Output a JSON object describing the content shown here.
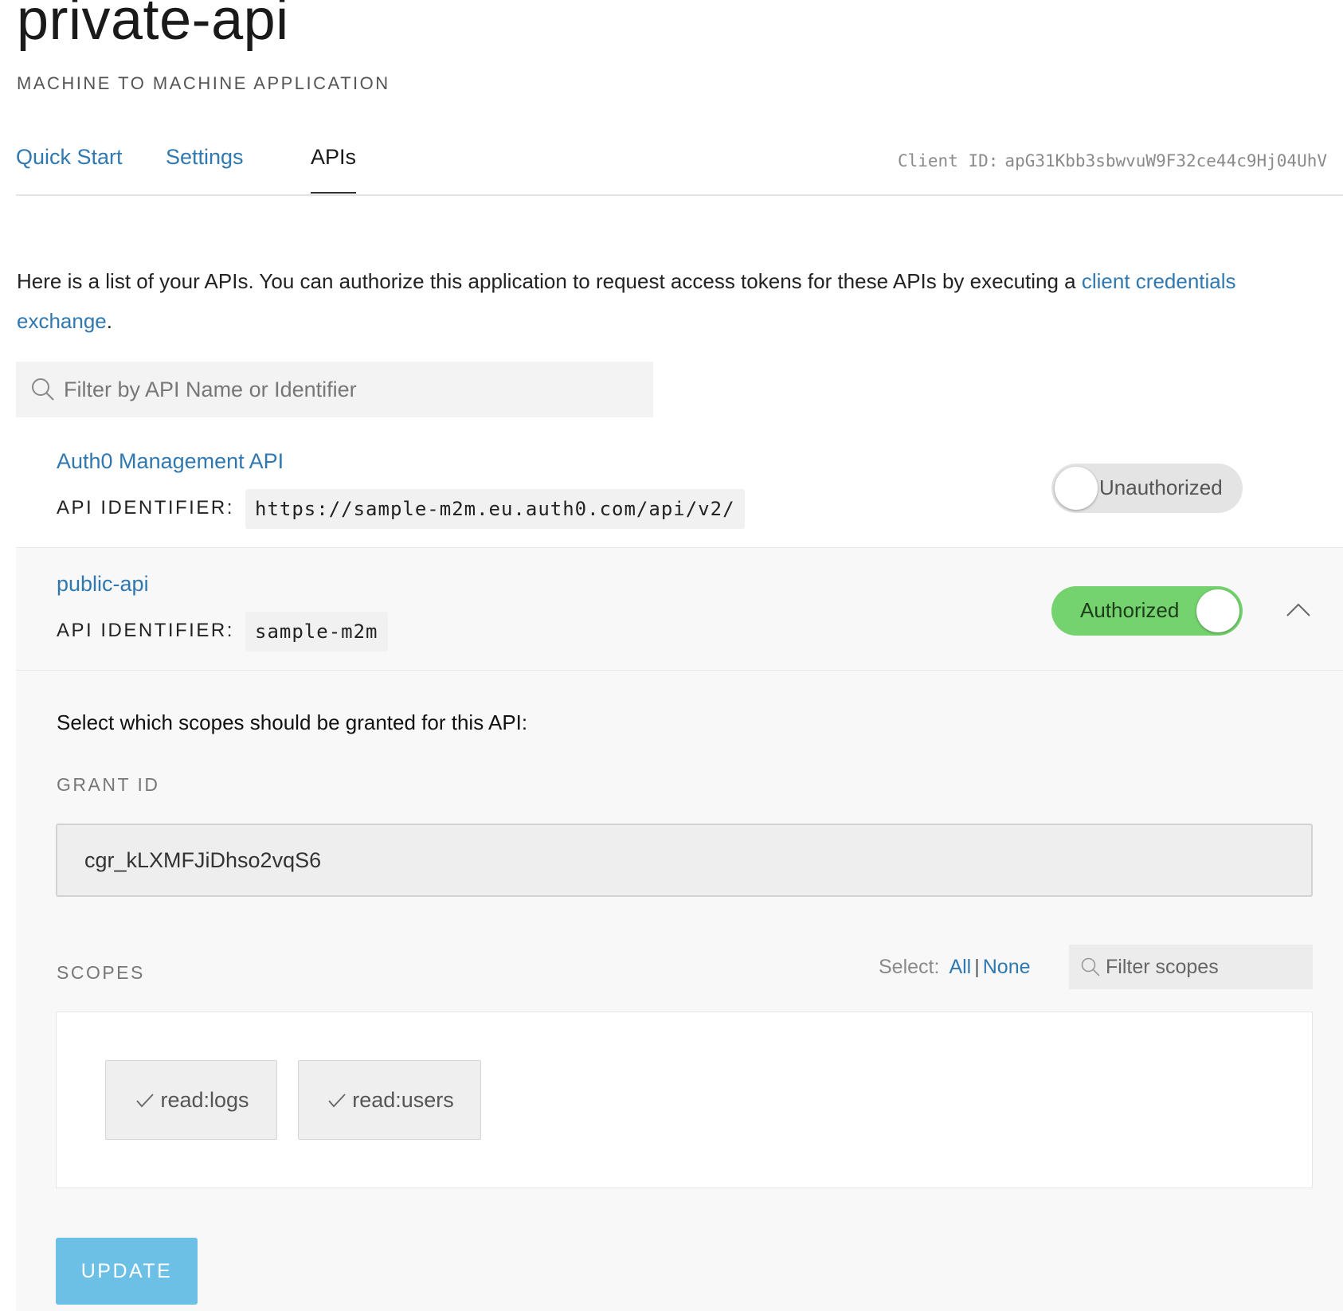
{
  "app": {
    "title": "private-api",
    "type": "MACHINE TO MACHINE APPLICATION"
  },
  "tabs": [
    {
      "label": "Quick Start"
    },
    {
      "label": "Settings"
    },
    {
      "label": "APIs",
      "active": true
    }
  ],
  "client_id": {
    "label": "Client ID:",
    "value": "apG31Kbb3sbwvuW9F32ce44c9Hj04UhV"
  },
  "intro": {
    "text": "Here is a list of your APIs. You can authorize this application to request access tokens for these APIs by executing a ",
    "link": "client credentials exchange",
    "suffix": "."
  },
  "search": {
    "placeholder": "Filter by API Name or Identifier"
  },
  "apis": [
    {
      "name": "Auth0 Management API",
      "identifier_label": "API IDENTIFIER:",
      "identifier": "https://sample-m2m.eu.auth0.com/api/v2/",
      "status": "Unauthorized",
      "authorized": false
    },
    {
      "name": "public-api",
      "identifier_label": "API IDENTIFIER:",
      "identifier": "sample-m2m",
      "status": "Authorized",
      "authorized": true,
      "expanded": true
    }
  ],
  "expanded": {
    "prompt": "Select which scopes should be granted for this API:",
    "grant_label": "GRANT ID",
    "grant_value": "cgr_kLXMFJiDhso2vqS6",
    "scopes_label": "SCOPES",
    "select_label": "Select:",
    "select_all": "All",
    "select_sep": "|",
    "select_none": "None",
    "filter_placeholder": "Filter scopes",
    "scopes": [
      {
        "name": "read:logs",
        "checked": true
      },
      {
        "name": "read:users",
        "checked": true
      }
    ],
    "update_label": "UPDATE"
  },
  "colors": {
    "link": "#3078b0",
    "toggle_on": "#74d36e",
    "toggle_off": "#e4e4e4",
    "update_button": "#6cc0e6"
  },
  "icons": [
    "search-icon",
    "chevron-up-icon",
    "check-icon"
  ]
}
